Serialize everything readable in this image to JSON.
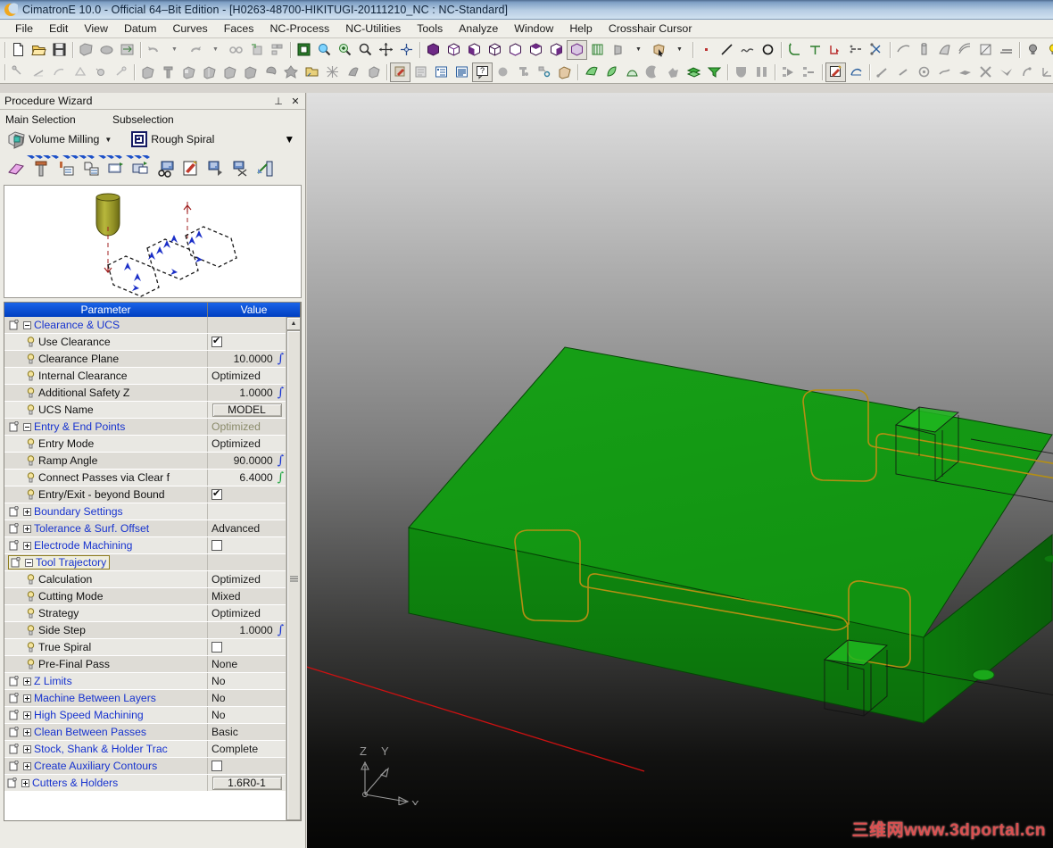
{
  "window": {
    "title": "CimatronE 10.0 - Official 64–Bit Edition - [H0263-48700-HIKITUGI-20111210_NC : NC-Standard]",
    "app_icon": "cimatron-moon-icon"
  },
  "menubar": {
    "items": [
      {
        "label": "File",
        "name": "menu-file"
      },
      {
        "label": "Edit",
        "name": "menu-edit"
      },
      {
        "label": "View",
        "name": "menu-view"
      },
      {
        "label": "Datum",
        "name": "menu-datum"
      },
      {
        "label": "Curves",
        "name": "menu-curves"
      },
      {
        "label": "Faces",
        "name": "menu-faces"
      },
      {
        "label": "NC-Process",
        "name": "menu-nc-process"
      },
      {
        "label": "NC-Utilities",
        "name": "menu-nc-utilities"
      },
      {
        "label": "Tools",
        "name": "menu-tools"
      },
      {
        "label": "Analyze",
        "name": "menu-analyze"
      },
      {
        "label": "Window",
        "name": "menu-window"
      },
      {
        "label": "Help",
        "name": "menu-help"
      },
      {
        "label": "Crosshair Cursor",
        "name": "menu-crosshair-cursor"
      }
    ]
  },
  "panel": {
    "title": "Procedure Wizard",
    "pin_glyph": "⊥",
    "close_glyph": "✕",
    "main_selection_label": "Main Selection",
    "subselection_label": "Subselection",
    "main_selection_value": "Volume Milling",
    "subselection_value": "Rough Spiral",
    "dropdown_glyph": "▼"
  },
  "grid": {
    "header": {
      "parameter": "Parameter",
      "value": "Value"
    },
    "rows": [
      {
        "level": "group",
        "expander": "minus",
        "icon": "group-icon",
        "label": "Clearance & UCS",
        "value": "",
        "type": "text"
      },
      {
        "level": "item",
        "icon": "bulb-icon",
        "label": "Use Clearance",
        "value": "",
        "type": "checkbox",
        "checked": true
      },
      {
        "level": "item",
        "icon": "bulb-icon",
        "label": "Clearance Plane",
        "value": "10.0000",
        "type": "number",
        "fx": "blue"
      },
      {
        "level": "item",
        "icon": "bulb-icon",
        "label": "Internal Clearance",
        "value": "Optimized",
        "type": "text"
      },
      {
        "level": "item",
        "icon": "bulb-icon",
        "label": "Additional Safety Z",
        "value": "1.0000",
        "type": "number",
        "fx": "blue"
      },
      {
        "level": "item",
        "icon": "bulb-icon",
        "label": "UCS Name",
        "value": "MODEL",
        "type": "button"
      },
      {
        "level": "group",
        "expander": "minus",
        "icon": "group-icon",
        "label": "Entry & End Points",
        "value": "Optimized",
        "type": "dim"
      },
      {
        "level": "item",
        "icon": "bulb-icon",
        "label": "Entry Mode",
        "value": "Optimized",
        "type": "text"
      },
      {
        "level": "item",
        "icon": "bulb-icon",
        "label": "Ramp Angle",
        "value": "90.0000",
        "type": "number",
        "fx": "blue"
      },
      {
        "level": "item",
        "icon": "bulb-icon",
        "label": "Connect Passes via Clear f",
        "value": "6.4000",
        "type": "number",
        "fx": "green"
      },
      {
        "level": "item",
        "icon": "bulb-icon",
        "label": "Entry/Exit - beyond Bound",
        "value": "",
        "type": "checkbox",
        "checked": true
      },
      {
        "level": "group",
        "expander": "plus",
        "icon": "group-icon",
        "label": "Boundary Settings",
        "value": "",
        "type": "text"
      },
      {
        "level": "group",
        "expander": "plus",
        "icon": "group-icon",
        "label": "Tolerance & Surf. Offset",
        "value": "Advanced",
        "type": "text"
      },
      {
        "level": "group",
        "expander": "plus",
        "icon": "group-icon",
        "label": "Electrode Machining",
        "value": "",
        "type": "checkbox",
        "checked": false
      },
      {
        "level": "group",
        "expander": "minus",
        "icon": "group-icon",
        "label": "Tool Trajectory",
        "value": "",
        "type": "text",
        "selected": true
      },
      {
        "level": "item",
        "icon": "bulb-icon",
        "label": "Calculation",
        "value": "Optimized",
        "type": "text"
      },
      {
        "level": "item",
        "icon": "bulb-icon",
        "label": "Cutting Mode",
        "value": "Mixed",
        "type": "text"
      },
      {
        "level": "item",
        "icon": "bulb-icon",
        "label": "Strategy",
        "value": "Optimized",
        "type": "text"
      },
      {
        "level": "item",
        "icon": "bulb-icon",
        "label": "Side Step",
        "value": "1.0000",
        "type": "number",
        "fx": "blue"
      },
      {
        "level": "item",
        "icon": "bulb-icon",
        "label": "True Spiral",
        "value": "",
        "type": "checkbox",
        "checked": false
      },
      {
        "level": "item",
        "icon": "bulb-icon",
        "label": "Pre-Final Pass",
        "value": "None",
        "type": "text"
      },
      {
        "level": "group",
        "expander": "plus",
        "icon": "group-icon",
        "label": "Z Limits",
        "value": "No",
        "type": "text"
      },
      {
        "level": "group",
        "expander": "plus",
        "icon": "group-icon",
        "label": "Machine Between Layers",
        "value": "No",
        "type": "text"
      },
      {
        "level": "group",
        "expander": "plus",
        "icon": "group-icon",
        "label": "High Speed Machining",
        "value": "No",
        "type": "text"
      },
      {
        "level": "group",
        "expander": "plus",
        "icon": "group-icon",
        "label": "Clean Between Passes",
        "value": "Basic",
        "type": "text"
      },
      {
        "level": "group",
        "expander": "plus",
        "icon": "group-icon",
        "label": "Stock, Shank & Holder Trac",
        "value": "Complete",
        "type": "text"
      },
      {
        "level": "group",
        "expander": "plus",
        "icon": "group-icon",
        "label": "Create Auxiliary Contours",
        "value": "",
        "type": "checkbox",
        "checked": false
      },
      {
        "level": "root",
        "expander": "plus",
        "icon": "group-icon",
        "label": "Cutters & Holders",
        "value": "1.6R0-1",
        "type": "button"
      }
    ]
  },
  "viewport": {
    "axis_labels": {
      "x": "X",
      "y": "Y",
      "z": "Z"
    },
    "watermark": "三维网www.3dportal.cn",
    "model_color": "#14a314",
    "model_edge_color": "#b58f13",
    "measure_line_color": "#cc1111"
  }
}
